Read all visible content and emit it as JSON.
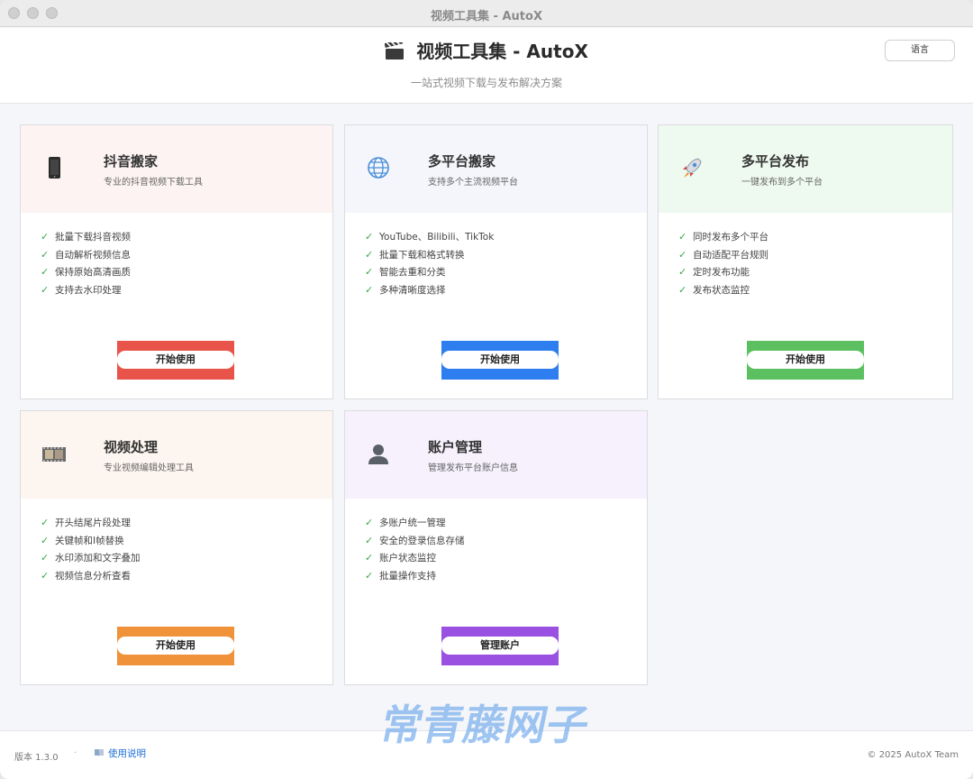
{
  "window": {
    "title": "视频工具集 - AutoX"
  },
  "header": {
    "title": "视频工具集 - AutoX",
    "subtitle": "一站式视频下载与发布解决方案",
    "language_label": "语言"
  },
  "cards": [
    {
      "title": "抖音搬家",
      "desc": "专业的抖音视频下载工具",
      "icon": "phone-icon",
      "head_color": "#fdf3f3",
      "button_color": "#e9544a",
      "features": [
        "批量下载抖音视频",
        "自动解析视频信息",
        "保持原始高清画质",
        "支持去水印处理"
      ],
      "button_label": "开始使用"
    },
    {
      "title": "多平台搬家",
      "desc": "支持多个主流视频平台",
      "icon": "globe-icon",
      "head_color": "#f4f6fb",
      "button_color": "#2f7ef0",
      "features": [
        "YouTube、Bilibili、TikTok",
        "批量下载和格式转换",
        "智能去重和分类",
        "多种清晰度选择"
      ],
      "button_label": "开始使用"
    },
    {
      "title": "多平台发布",
      "desc": "一键发布到多个平台",
      "icon": "rocket-icon",
      "head_color": "#eefaef",
      "button_color": "#5cc060",
      "features": [
        "同时发布多个平台",
        "自动适配平台规则",
        "定时发布功能",
        "发布状态监控"
      ],
      "button_label": "开始使用"
    },
    {
      "title": "视频处理",
      "desc": "专业视频编辑处理工具",
      "icon": "film-icon",
      "head_color": "#fdf5ef",
      "button_color": "#f0923a",
      "features": [
        "开头结尾片段处理",
        "关键帧和I帧替换",
        "水印添加和文字叠加",
        "视频信息分析查看"
      ],
      "button_label": "开始使用"
    },
    {
      "title": "账户管理",
      "desc": "管理发布平台账户信息",
      "icon": "user-icon",
      "head_color": "#f6f1fc",
      "button_color": "#9a50e0",
      "features": [
        "多账户统一管理",
        "安全的登录信息存储",
        "账户状态监控",
        "批量操作支持"
      ],
      "button_label": "管理账户"
    }
  ],
  "footer": {
    "version": "版本 1.3.0",
    "separator": "·",
    "help_link": "使用说明",
    "copyright": "© 2025 AutoX Team"
  },
  "watermark": {
    "text": "常青藤网子"
  }
}
